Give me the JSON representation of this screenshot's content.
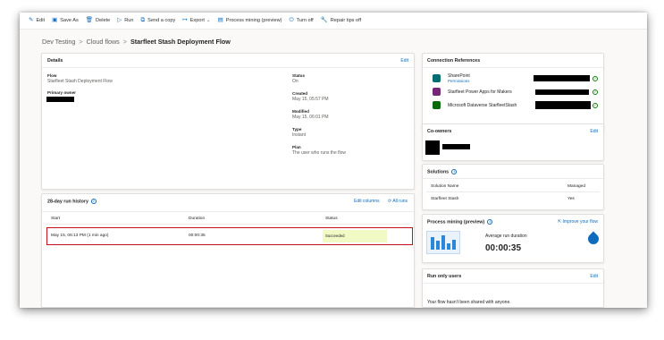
{
  "toolbar": {
    "edit": "Edit",
    "save_as": "Save As",
    "delete": "Delete",
    "run": "Run",
    "send_copy": "Send a copy",
    "export": "Export",
    "process_mining": "Process mining (preview)",
    "turn_off": "Turn off",
    "repair_tips": "Repair tips off"
  },
  "breadcrumb": {
    "root": "Dev Testing",
    "section": "Cloud flows",
    "current": "Starfleet Stash Deployment Flow"
  },
  "details": {
    "title": "Details",
    "edit": "Edit",
    "flow_label": "Flow",
    "flow_value": "Starfleet Stash Deployment Flow",
    "owner_label": "Primary owner",
    "status_label": "Status",
    "status_value": "On",
    "created_label": "Created",
    "created_value": "May 15, 05:57 PM",
    "modified_label": "Modified",
    "modified_value": "May 15, 06:01 PM",
    "type_label": "Type",
    "type_value": "Instant",
    "plan_label": "Plan",
    "plan_value": "The user who runs the flow"
  },
  "run_history": {
    "title": "28-day run history",
    "edit_columns": "Edit columns",
    "all_runs": "All runs",
    "col_start": "Start",
    "col_duration": "Duration",
    "col_status": "Status",
    "rows": [
      {
        "start": "May 15, 06:13 PM (1 min ago)",
        "duration": "00:00:35",
        "status": "Succeeded"
      }
    ]
  },
  "connections": {
    "title": "Connection References",
    "items": [
      {
        "name": "SharePoint",
        "sub": "Permissions"
      },
      {
        "name": "Starfleet Power Apps for Makers",
        "sub": ""
      },
      {
        "name": "Microsoft Dataverse StarfleetStash",
        "sub": ""
      }
    ]
  },
  "co_owners": {
    "title": "Co-owners",
    "edit": "Edit"
  },
  "solutions": {
    "title": "Solutions",
    "col_name": "Solution Name",
    "col_managed": "Managed",
    "rows": [
      {
        "name": "Starfleet Stash",
        "managed": "Yes"
      }
    ]
  },
  "process_mining": {
    "title": "Process mining (preview)",
    "improve": "Improve your flow",
    "avg_label": "Average run duration",
    "avg_value": "00:00:35"
  },
  "run_only": {
    "title": "Run only users",
    "edit": "Edit",
    "message": "Your flow hasn't been shared with anyone."
  },
  "colors": {
    "accent": "#0f6cbd",
    "highlight_border": "#c50f1f",
    "success_bg": "#f1f9c4",
    "sharepoint": "#036c70",
    "powerapps": "#742774",
    "dataverse": "#0b6a0b"
  }
}
